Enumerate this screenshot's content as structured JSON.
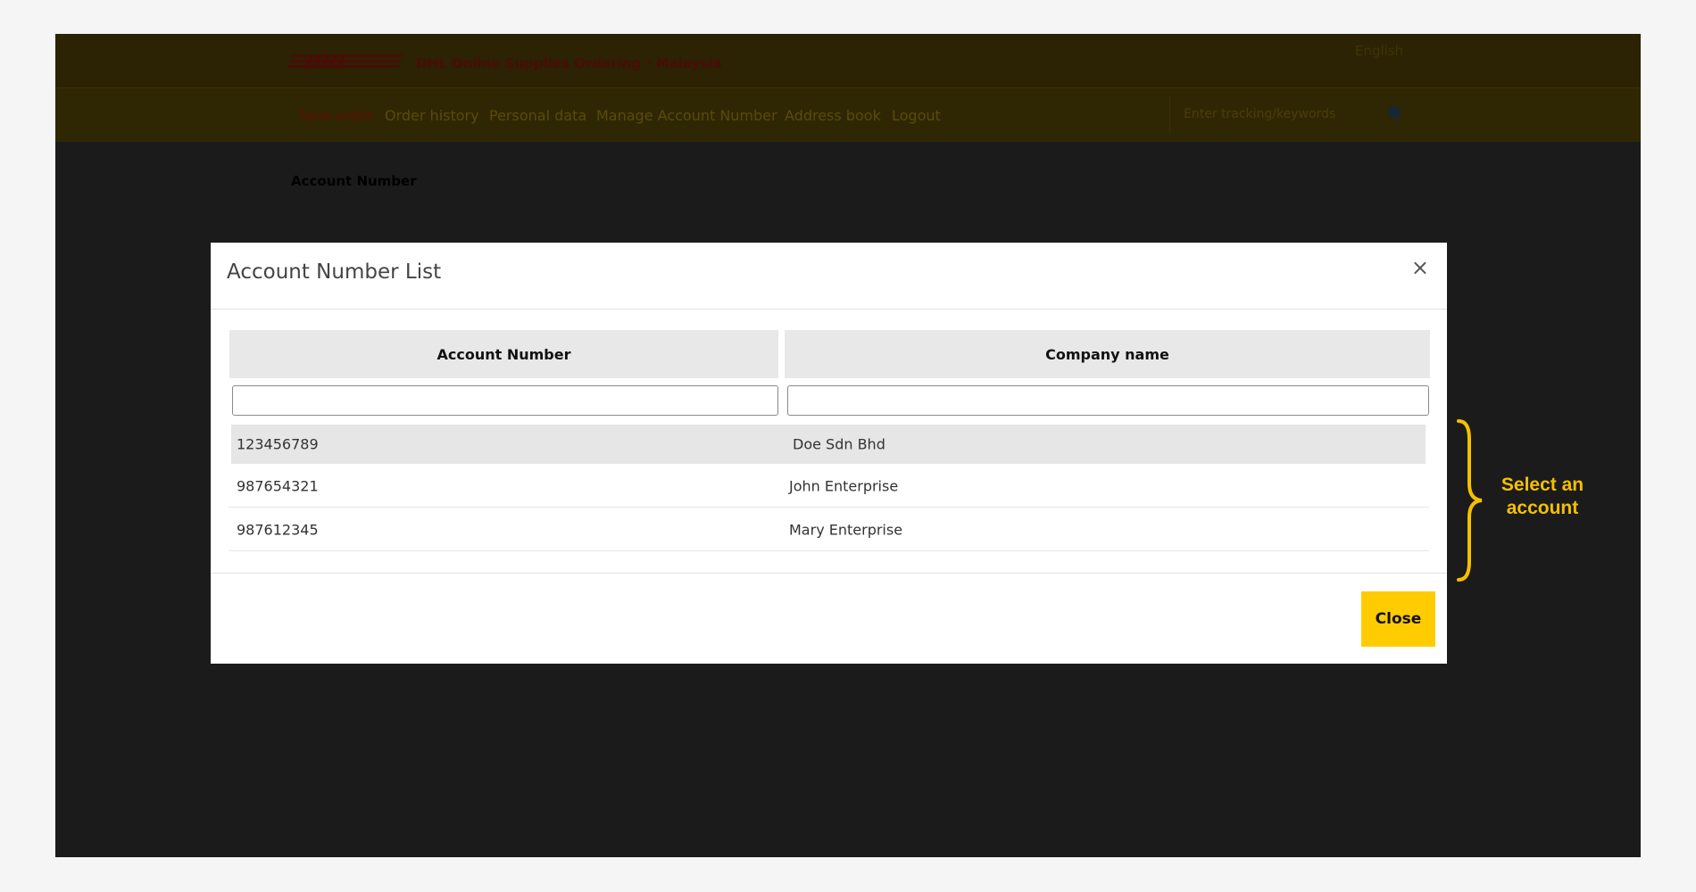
{
  "app": {
    "logo_text": "DHL",
    "title": "DHL Online Supplies Ordering - Malaysia",
    "language": "English"
  },
  "nav": {
    "items": [
      "New order",
      "Order history",
      "Personal data",
      "Manage Account Number",
      "Address book",
      "Logout"
    ],
    "search_text": "Enter tracking/keywords"
  },
  "page": {
    "heading": "Account Number"
  },
  "modal": {
    "title": "Account Number List",
    "close_x": "×",
    "columns": [
      "Account Number",
      "Company name"
    ],
    "rows": [
      {
        "account": "123456789",
        "company": "Doe Sdn Bhd"
      },
      {
        "account": "987654321",
        "company": "John Enterprise"
      },
      {
        "account": "987612345",
        "company": "Mary Enterprise"
      }
    ],
    "close_button": "Close"
  },
  "annotation": {
    "line1": "Select an",
    "line2": "account",
    "color": "#f5c000"
  },
  "colors": {
    "accent": "#fecc00",
    "overlay": "#1b1b1b"
  }
}
